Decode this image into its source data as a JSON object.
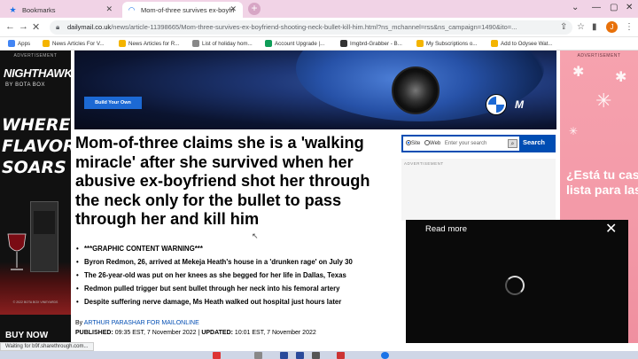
{
  "browser": {
    "tabs": [
      {
        "title": "Bookmarks",
        "icon": "star-icon",
        "active": false
      },
      {
        "title": "Mom-of-three survives ex-boyfri",
        "icon": "loading-icon",
        "active": true
      }
    ],
    "new_tab_label": "+",
    "url_host": "dailymail.co.uk",
    "url_path": "/news/article-11398665/Mom-three-survives-ex-boyfriend-shooting-neck-bullet-kill-him.html?ns_mchannel=rss&ns_campaign=1490&ito=...",
    "profile_initial": "J",
    "bookmarks": [
      {
        "label": "Apps",
        "color": "#4285f4"
      },
      {
        "label": "News Articles For V...",
        "color": "#f4b400"
      },
      {
        "label": "News Articles for R...",
        "color": "#f4b400"
      },
      {
        "label": "List of holiday hom...",
        "color": "#888888"
      },
      {
        "label": "Account Upgrade |...",
        "color": "#0f9d58"
      },
      {
        "label": "Imgbrd-Grabber - B...",
        "color": "#333333"
      },
      {
        "label": "My Subscriptions o...",
        "color": "#f4b400"
      },
      {
        "label": "Add to Odysee Wat...",
        "color": "#f4b400"
      }
    ],
    "status_text": "Waiting for b9f.sharethrough.com..."
  },
  "left_ad": {
    "label": "ADVERTISEMENT",
    "brand": "NIGHTHAWK",
    "brand_sub": "BY BOTA BOX",
    "headline": "WHERE FLAVOR SOARS",
    "fine_print": "© 2022 BOTA BOX VINEYARDS",
    "cta": "BUY NOW"
  },
  "right_ad": {
    "label": "ADVERTISEMENT",
    "text": "¿Está tu casa lista para las"
  },
  "hero_ad": {
    "cta": "Build Your Own",
    "brand_letter": "M"
  },
  "article": {
    "headline": "Mom-of-three claims she is a 'walking miracle' after she survived when her abusive ex-boyfriend shot her through the neck only for the bullet to pass through her and kill him",
    "bullets": [
      "***GRAPHIC CONTENT WARNING***",
      "Byron Redmon, 26, arrived at Mekeja Heath's house in a 'drunken rage' on July 30",
      "The 26-year-old was put on her knees as she begged for her life in Dallas, Texas",
      "Redmon pulled trigger but sent bullet through her neck into his femoral artery",
      "Despite suffering nerve damage, Ms Heath walked out hospital just hours later"
    ],
    "byline_prefix": "By ",
    "author": "ARTHUR PARASHAR FOR MAILONLINE",
    "published_label": "PUBLISHED:",
    "published": "09:35 EST, 7 November 2022",
    "separator": "|",
    "updated_label": "UPDATED:",
    "updated": "10:01 EST, 7 November 2022"
  },
  "search": {
    "option_site": "Site",
    "option_web": "Web",
    "placeholder": "Enter your search",
    "button": "Search"
  },
  "side_ad_label": "ADVERTISEMENT",
  "video_popup": {
    "read_more": "Read more",
    "close": "✕"
  }
}
